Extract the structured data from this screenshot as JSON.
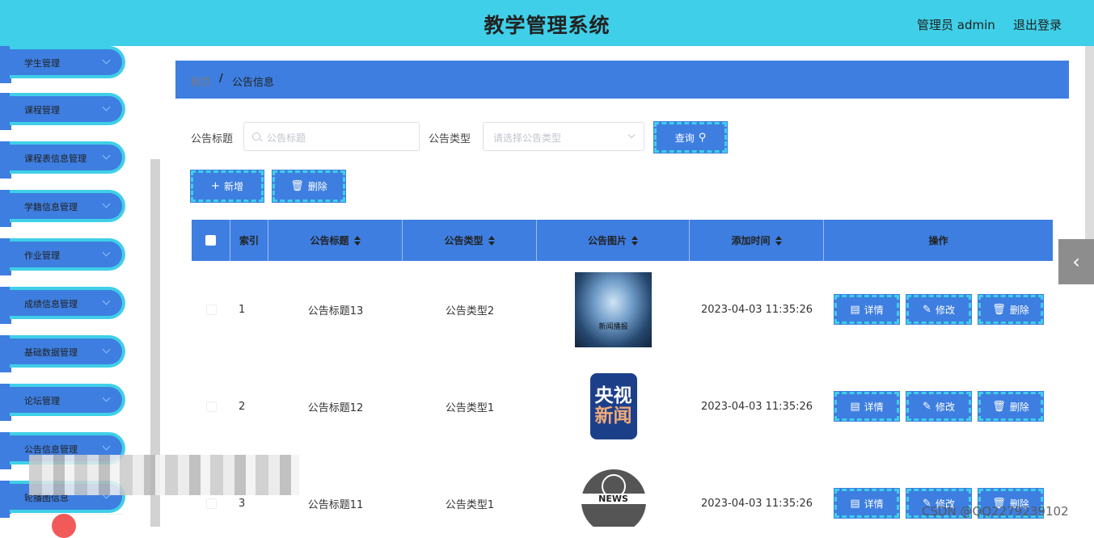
{
  "header": {
    "title": "教学管理系统",
    "user": "管理员 admin",
    "logout": "退出登录"
  },
  "sidebar": {
    "items": [
      {
        "label": "学生管理"
      },
      {
        "label": "课程管理"
      },
      {
        "label": "课程表信息管理"
      },
      {
        "label": "学籍信息管理"
      },
      {
        "label": "作业管理"
      },
      {
        "label": "成绩信息管理"
      },
      {
        "label": "基础数据管理"
      },
      {
        "label": "论坛管理"
      },
      {
        "label": "公告信息管理"
      },
      {
        "label": "轮播图信息"
      }
    ]
  },
  "breadcrumb": {
    "home": "首页",
    "separator": "/",
    "current": "公告信息"
  },
  "filters": {
    "title_label": "公告标题",
    "title_placeholder": "公告标题",
    "type_label": "公告类型",
    "type_placeholder": "请选择公告类型",
    "query_button": "查询",
    "query_icon": "search-icon"
  },
  "actions": {
    "add": "新增",
    "add_icon": "+",
    "delete": "删除",
    "delete_icon": "🗑"
  },
  "table": {
    "headers": {
      "index": "索引",
      "title": "公告标题",
      "type": "公告类型",
      "image": "公告图片",
      "time": "添加时间",
      "ops": "操作"
    },
    "row_buttons": {
      "detail": "详情",
      "edit": "修改",
      "delete": "删除",
      "detail_icon": "▤",
      "edit_icon": "✎",
      "delete_icon": "🗑"
    },
    "rows": [
      {
        "index": "1",
        "title": "公告标题13",
        "type": "公告类型2",
        "time": "2023-04-03 11:35:26",
        "image_text": "新闻播报"
      },
      {
        "index": "2",
        "title": "公告标题12",
        "type": "公告类型1",
        "time": "2023-04-03 11:35:26",
        "image_text_a": "央视",
        "image_text_b": "新闻"
      },
      {
        "index": "3",
        "title": "公告标题11",
        "type": "公告类型1",
        "time": "2023-04-03 11:35:26",
        "image_text": "NEWS"
      }
    ]
  },
  "side_toggle_icon": "‹",
  "watermark": "CSDN @QQ2279239102",
  "colors": {
    "header": "#3fcfe8",
    "primary": "#3e7ee0"
  }
}
